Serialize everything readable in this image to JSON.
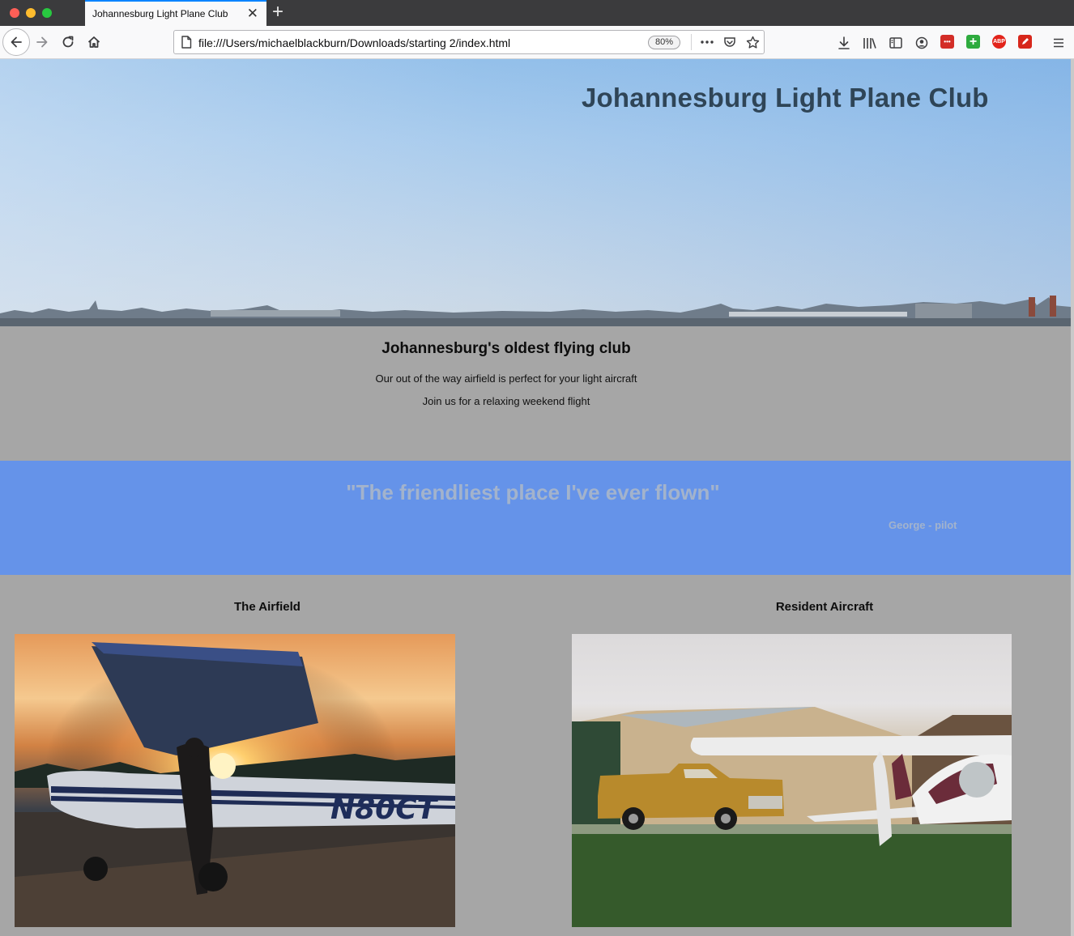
{
  "browser": {
    "tab_title": "Johannesburg Light Plane Club",
    "url": "file:///Users/michaelblackburn/Downloads/starting 2/index.html",
    "zoom": "80%",
    "extensions": {
      "abp_label": "ABP",
      "lastpass_label": "•••"
    }
  },
  "hero": {
    "title": "Johannesburg Light Plane Club"
  },
  "intro": {
    "title": "Johannesburg's oldest flying club",
    "line1": "Our out of the way airfield is perfect for your light aircraft",
    "line2": "Join us for a relaxing weekend flight"
  },
  "testimonial": {
    "quote": "\"The friendliest place I've ever flown\"",
    "author": "George - pilot"
  },
  "columns": [
    {
      "title": "The Airfield",
      "tail_number": "N80CT"
    },
    {
      "title": "Resident Aircraft"
    }
  ],
  "colors": {
    "quote_band": "#6593e9",
    "page_background": "#a6a6a6",
    "quote_text": "#a3b3cc"
  }
}
